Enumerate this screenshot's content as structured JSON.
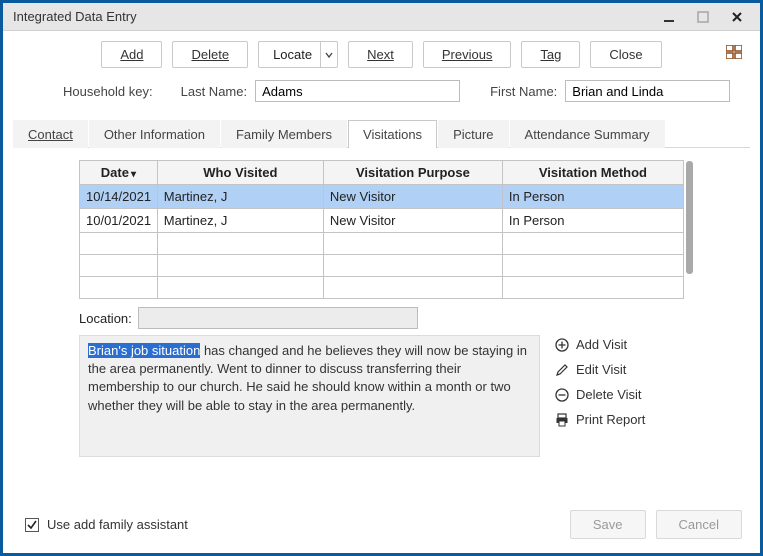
{
  "window": {
    "title": "Integrated Data Entry"
  },
  "toolbar": {
    "add": "Add",
    "delete": "Delete",
    "locate": "Locate",
    "next": "Next",
    "previous": "Previous",
    "tag": "Tag",
    "close": "Close"
  },
  "household": {
    "key_label": "Household key:",
    "lastname_label": "Last Name:",
    "lastname_value": "Adams",
    "firstname_label": "First Name:",
    "firstname_value": "Brian and Linda"
  },
  "tabs": {
    "contact": "Contact",
    "other": "Other Information",
    "family": "Family Members",
    "visitations": "Visitations",
    "picture": "Picture",
    "attendance": "Attendance Summary"
  },
  "grid": {
    "headers": {
      "date": "Date",
      "who": "Who Visited",
      "purpose": "Visitation Purpose",
      "method": "Visitation Method"
    },
    "rows": [
      {
        "date": "10/14/2021",
        "who": "Martinez, J",
        "purpose": "New Visitor",
        "method": "In Person"
      },
      {
        "date": "10/01/2021",
        "who": "Martinez, J",
        "purpose": "New Visitor",
        "method": "In Person"
      }
    ]
  },
  "location": {
    "label": "Location:",
    "value": ""
  },
  "notes": {
    "highlight": "Brian's job situation",
    "rest": " has changed and he believes they will now be staying in the area permanently.  Went to dinner to discuss transferring their membership to our church.  He said he should know within a month or two whether they will be able to stay in the area permanently."
  },
  "actions": {
    "add": "Add Visit",
    "edit": "Edit Visit",
    "delete": "Delete Visit",
    "print": "Print Report"
  },
  "footer": {
    "assistant_label": "Use add family assistant",
    "assistant_checked": true,
    "save": "Save",
    "cancel": "Cancel"
  }
}
